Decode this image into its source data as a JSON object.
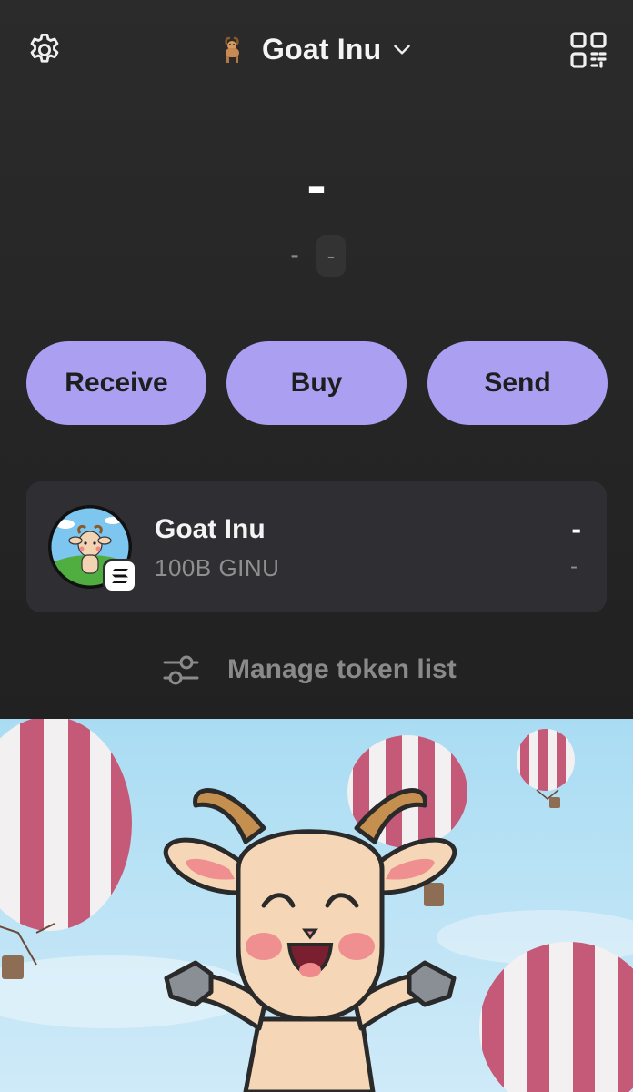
{
  "header": {
    "settings_icon": "gear-icon",
    "account_emoji": "goat-emoji",
    "account_name": "Goat Inu",
    "dropdown_icon": "chevron-down-icon",
    "qr_icon": "qr-code-icon"
  },
  "balance": {
    "value": "-",
    "change_usd": "-",
    "change_percent": "-"
  },
  "actions": {
    "receive": "Receive",
    "buy": "Buy",
    "send": "Send"
  },
  "token": {
    "name": "Goat Inu",
    "amount": "100B GINU",
    "value": "-",
    "change": "-",
    "network_badge_icon": "solana-icon"
  },
  "manage": {
    "icon": "sliders-icon",
    "label": "Manage token list"
  },
  "banner": {
    "image": "goat-balloons-illustration"
  },
  "colors": {
    "background": "#252525",
    "accent": "#ab9ff2",
    "card": "#2f2f33",
    "muted_text": "#8a8a8a"
  }
}
